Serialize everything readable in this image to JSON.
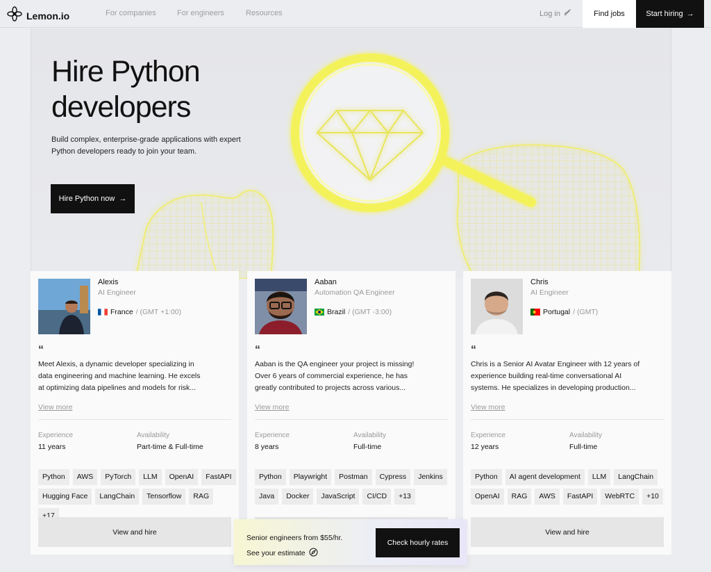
{
  "header": {
    "logo_text": "Lemon.io",
    "nav": [
      "For companies",
      "For engineers",
      "Resources"
    ],
    "login": "Log in",
    "find_jobs": "Find jobs",
    "start_hiring": "Start hiring"
  },
  "hero": {
    "title": "Hire Python developers",
    "subtitle": "Build complex, enterprise-grade applications with expert Python developers ready to join your team.",
    "cta": "Hire Python now"
  },
  "labels": {
    "experience": "Experience",
    "availability": "Availability",
    "view_more": "View more",
    "view_and_hire": "View and hire",
    "quote_mark": "“"
  },
  "cards": [
    {
      "name": "Alexis",
      "role": "AI Engineer",
      "country": "France",
      "timezone": "/ (GMT +1:00)",
      "description": "Meet Alexis, a dynamic developer specializing in data engineering and machine learning. He excels at optimizing data pipelines and models for risk...",
      "experience": "11 years",
      "availability": "Part-time & Full-time",
      "skills": [
        "Python",
        "AWS",
        "PyTorch",
        "LLM",
        "OpenAI",
        "FastAPI",
        "Hugging Face",
        "LangChain",
        "Tensorflow",
        "RAG",
        "+17"
      ]
    },
    {
      "name": "Aaban",
      "role": "Automation QA Engineer",
      "country": "Brazil",
      "timezone": "/ (GMT -3:00)",
      "description": "Aaban is the QA engineer your project is missing! Over 6 years of commercial experience, he has greatly contributed to projects across various...",
      "experience": "8 years",
      "availability": "Full-time",
      "skills": [
        "Python",
        "Playwright",
        "Postman",
        "Cypress",
        "Jenkins",
        "Java",
        "Docker",
        "JavaScript",
        "CI/CD",
        "+13"
      ]
    },
    {
      "name": "Chris",
      "role": "AI Engineer",
      "country": "Portugal",
      "timezone": "/ (GMT)",
      "description": "Chris is a Senior AI Avatar Engineer with 12 years of experience building real-time conversational AI systems. He specializes in developing production...",
      "experience": "12 years",
      "availability": "Full-time",
      "skills": [
        "Python",
        "AI agent development",
        "LLM",
        "LangChain",
        "OpenAI",
        "RAG",
        "AWS",
        "FastAPI",
        "WebRTC",
        "+10"
      ]
    }
  ],
  "rates_banner": {
    "text": "Senior engineers from $55/hr.",
    "estimate": "See your estimate",
    "button": "Check hourly rates"
  },
  "colors": {
    "accent_dark": "#111111",
    "glow_yellow": "#f4f25a",
    "background": "#ecedf0"
  }
}
